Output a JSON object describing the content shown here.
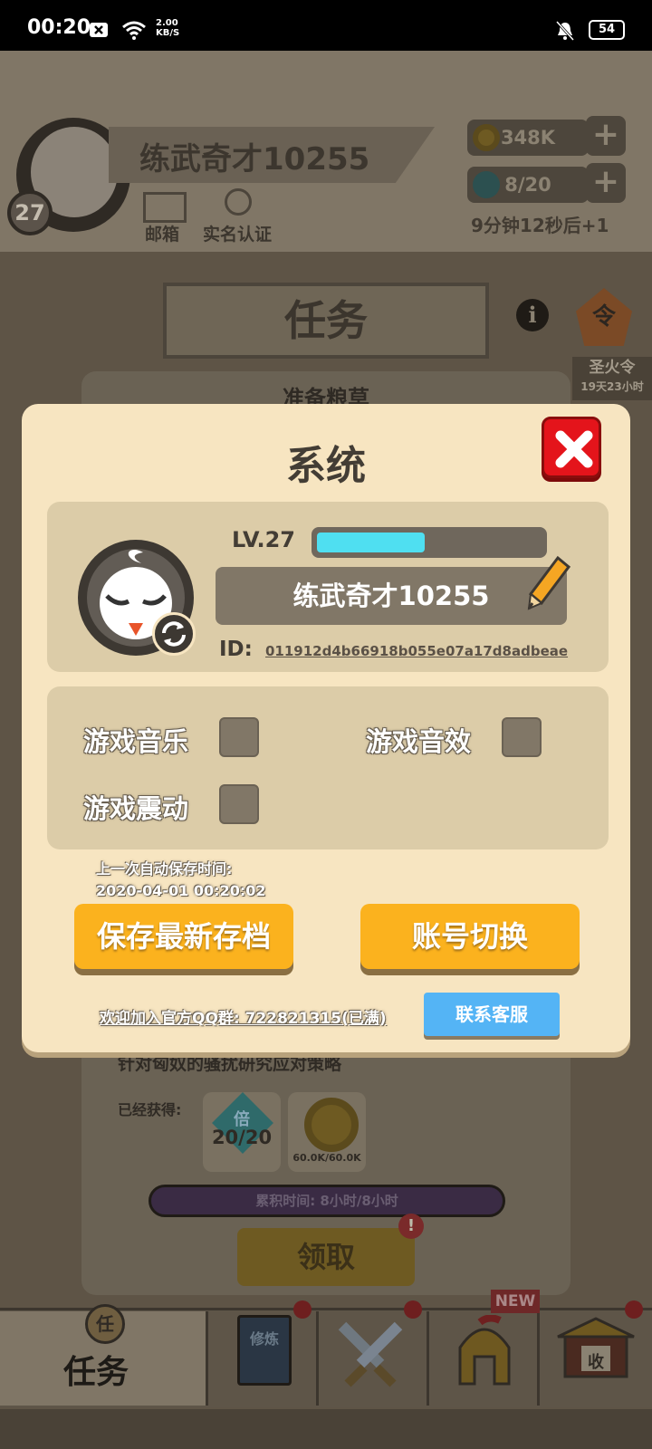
{
  "status_bar": {
    "time": "00:20",
    "net_speed_value": "2.00",
    "net_speed_unit": "KB/S",
    "battery": "54"
  },
  "header": {
    "player_name": "练武奇才10255",
    "level": "27",
    "mail_label": "邮箱",
    "verify_label": "实名认证",
    "coins": "348K",
    "energy": "8/20",
    "energy_timer": "9分钟12秒后+1"
  },
  "task_screen": {
    "title": "任务",
    "card_title": "准备粮草",
    "description": "针对匈奴的骚扰研究应对策略",
    "obtained_label": "已经获得:",
    "reward_multiplier": "20/20",
    "reward_coins": "60.0K/60.0K",
    "accumulated": "累积时间: 8小时/8小时",
    "claim_label": "领取",
    "order_name": "圣火令",
    "order_timer": "19天23小时",
    "order_glyph": "令",
    "multiplier_glyph": "倍"
  },
  "bottom_nav": {
    "active_tab": "任务",
    "active_glyph": "任",
    "train_glyph": "修炼",
    "collect_glyph": "收",
    "new_badge": "NEW"
  },
  "dialog": {
    "title": "系统",
    "level_label": "LV.27",
    "xp_fraction": 0.48,
    "player_name": "练武奇才10255",
    "id_label": "ID:",
    "id_value": "011912d4b66918b055e07a17d8adbeae",
    "settings": {
      "music_label": "游戏音乐",
      "sfx_label": "游戏音效",
      "vibration_label": "游戏震动"
    },
    "autosave_label": "上一次自动保存时间:",
    "autosave_time": "2020-04-01 00:20:02",
    "save_button": "保存最新存档",
    "switch_button": "账号切换",
    "qq_group": "欢迎加入官方QQ群: 722821315(已满)",
    "contact_button": "联系客服"
  },
  "colors": {
    "dialog_bg": "#f7e5c1",
    "panel_bg": "#dccca8",
    "accent_orange": "#fbb21e",
    "accent_blue": "#54b4f5",
    "close_red": "#e4141b",
    "xp_cyan": "#4fdff1"
  },
  "icons": [
    "mail-icon",
    "verify-icon",
    "coin-icon",
    "energy-icon",
    "plus-icon",
    "info-icon",
    "close-icon",
    "refresh-icon",
    "pencil-icon",
    "swords-icon",
    "helmet-icon",
    "book-icon",
    "gate-icon"
  ]
}
